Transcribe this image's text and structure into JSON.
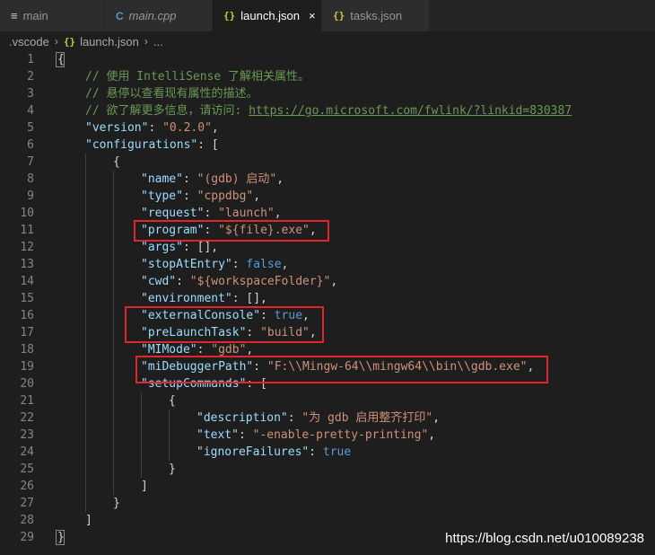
{
  "tabs": [
    {
      "label": "main",
      "icon": "lines-icon",
      "active": false
    },
    {
      "label": "main.cpp",
      "icon": "cpp-icon",
      "active": false
    },
    {
      "label": "launch.json",
      "icon": "json-braces-icon",
      "active": true,
      "close": "×"
    },
    {
      "label": "tasks.json",
      "icon": "json-braces-icon",
      "active": false
    }
  ],
  "breadcrumb": {
    "folder": ".vscode",
    "file": "launch.json",
    "rest": "..."
  },
  "icons": {
    "json": "{}",
    "cpp": "C"
  },
  "code_lines": [
    {
      "n": "1",
      "indent": 0,
      "parts": [
        [
          "p",
          "{"
        ]
      ]
    },
    {
      "n": "2",
      "indent": 1,
      "parts": [
        [
          "c",
          "// 使用 IntelliSense 了解相关属性。"
        ]
      ]
    },
    {
      "n": "3",
      "indent": 1,
      "parts": [
        [
          "c",
          "// 悬停以查看现有属性的描述。"
        ]
      ]
    },
    {
      "n": "4",
      "indent": 1,
      "parts": [
        [
          "c",
          "// 欲了解更多信息，请访问: "
        ],
        [
          "u",
          "https://go.microsoft.com/fwlink/?linkid=830387"
        ]
      ]
    },
    {
      "n": "5",
      "indent": 1,
      "parts": [
        [
          "k",
          "\"version\""
        ],
        [
          "p",
          ": "
        ],
        [
          "s",
          "\"0.2.0\""
        ],
        [
          "p",
          ","
        ]
      ]
    },
    {
      "n": "6",
      "indent": 1,
      "parts": [
        [
          "k",
          "\"configurations\""
        ],
        [
          "p",
          ": ["
        ]
      ]
    },
    {
      "n": "7",
      "indent": 2,
      "parts": [
        [
          "p",
          "{"
        ]
      ]
    },
    {
      "n": "8",
      "indent": 3,
      "parts": [
        [
          "k",
          "\"name\""
        ],
        [
          "p",
          ": "
        ],
        [
          "s",
          "\"(gdb) 启动\""
        ],
        [
          "p",
          ","
        ]
      ]
    },
    {
      "n": "9",
      "indent": 3,
      "parts": [
        [
          "k",
          "\"type\""
        ],
        [
          "p",
          ": "
        ],
        [
          "s",
          "\"cppdbg\""
        ],
        [
          "p",
          ","
        ]
      ]
    },
    {
      "n": "10",
      "indent": 3,
      "parts": [
        [
          "k",
          "\"request\""
        ],
        [
          "p",
          ": "
        ],
        [
          "s",
          "\"launch\""
        ],
        [
          "p",
          ","
        ]
      ]
    },
    {
      "n": "11",
      "indent": 3,
      "parts": [
        [
          "k",
          "\"program\""
        ],
        [
          "p",
          ": "
        ],
        [
          "s",
          "\"${file}.exe\""
        ],
        [
          "p",
          ","
        ]
      ]
    },
    {
      "n": "12",
      "indent": 3,
      "parts": [
        [
          "k",
          "\"args\""
        ],
        [
          "p",
          ": [],"
        ]
      ]
    },
    {
      "n": "13",
      "indent": 3,
      "parts": [
        [
          "k",
          "\"stopAtEntry\""
        ],
        [
          "p",
          ": "
        ],
        [
          "b",
          "false"
        ],
        [
          "p",
          ","
        ]
      ]
    },
    {
      "n": "14",
      "indent": 3,
      "parts": [
        [
          "k",
          "\"cwd\""
        ],
        [
          "p",
          ": "
        ],
        [
          "s",
          "\"${workspaceFolder}\""
        ],
        [
          "p",
          ","
        ]
      ]
    },
    {
      "n": "15",
      "indent": 3,
      "parts": [
        [
          "k",
          "\"environment\""
        ],
        [
          "p",
          ": [],"
        ]
      ]
    },
    {
      "n": "16",
      "indent": 3,
      "parts": [
        [
          "k",
          "\"externalConsole\""
        ],
        [
          "p",
          ": "
        ],
        [
          "b",
          "true"
        ],
        [
          "p",
          ","
        ]
      ]
    },
    {
      "n": "17",
      "indent": 3,
      "parts": [
        [
          "k",
          "\"preLaunchTask\""
        ],
        [
          "p",
          ": "
        ],
        [
          "s",
          "\"build\""
        ],
        [
          "p",
          ","
        ]
      ]
    },
    {
      "n": "18",
      "indent": 3,
      "parts": [
        [
          "k",
          "\"MIMode\""
        ],
        [
          "p",
          ": "
        ],
        [
          "s",
          "\"gdb\""
        ],
        [
          "p",
          ","
        ]
      ]
    },
    {
      "n": "19",
      "indent": 3,
      "parts": [
        [
          "k",
          "\"miDebuggerPath\""
        ],
        [
          "p",
          ": "
        ],
        [
          "s",
          "\"F:\\\\Mingw-64\\\\mingw64\\\\bin\\\\gdb.exe\""
        ],
        [
          "p",
          ","
        ]
      ]
    },
    {
      "n": "20",
      "indent": 3,
      "parts": [
        [
          "k",
          "\"setupCommands\""
        ],
        [
          "p",
          ": ["
        ]
      ]
    },
    {
      "n": "21",
      "indent": 4,
      "parts": [
        [
          "p",
          "{"
        ]
      ]
    },
    {
      "n": "22",
      "indent": 5,
      "parts": [
        [
          "k",
          "\"description\""
        ],
        [
          "p",
          ": "
        ],
        [
          "s",
          "\"为 gdb 启用整齐打印\""
        ],
        [
          "p",
          ","
        ]
      ]
    },
    {
      "n": "23",
      "indent": 5,
      "parts": [
        [
          "k",
          "\"text\""
        ],
        [
          "p",
          ": "
        ],
        [
          "s",
          "\"-enable-pretty-printing\""
        ],
        [
          "p",
          ","
        ]
      ]
    },
    {
      "n": "24",
      "indent": 5,
      "parts": [
        [
          "k",
          "\"ignoreFailures\""
        ],
        [
          "p",
          ": "
        ],
        [
          "b",
          "true"
        ]
      ]
    },
    {
      "n": "25",
      "indent": 4,
      "parts": [
        [
          "p",
          "}"
        ]
      ]
    },
    {
      "n": "26",
      "indent": 3,
      "parts": [
        [
          "p",
          "]"
        ]
      ]
    },
    {
      "n": "27",
      "indent": 2,
      "parts": [
        [
          "p",
          "}"
        ]
      ]
    },
    {
      "n": "28",
      "indent": 1,
      "parts": [
        [
          "p",
          "]"
        ]
      ]
    },
    {
      "n": "29",
      "indent": 0,
      "parts": [
        [
          "p",
          "}"
        ]
      ]
    }
  ],
  "colors": {
    "key": "#9cdcfe",
    "string": "#ce9178",
    "comment": "#6a9955",
    "keyword": "#569cd6",
    "highlight_box": "#e0262b"
  },
  "watermark": "https://blog.csdn.net/u010089238"
}
